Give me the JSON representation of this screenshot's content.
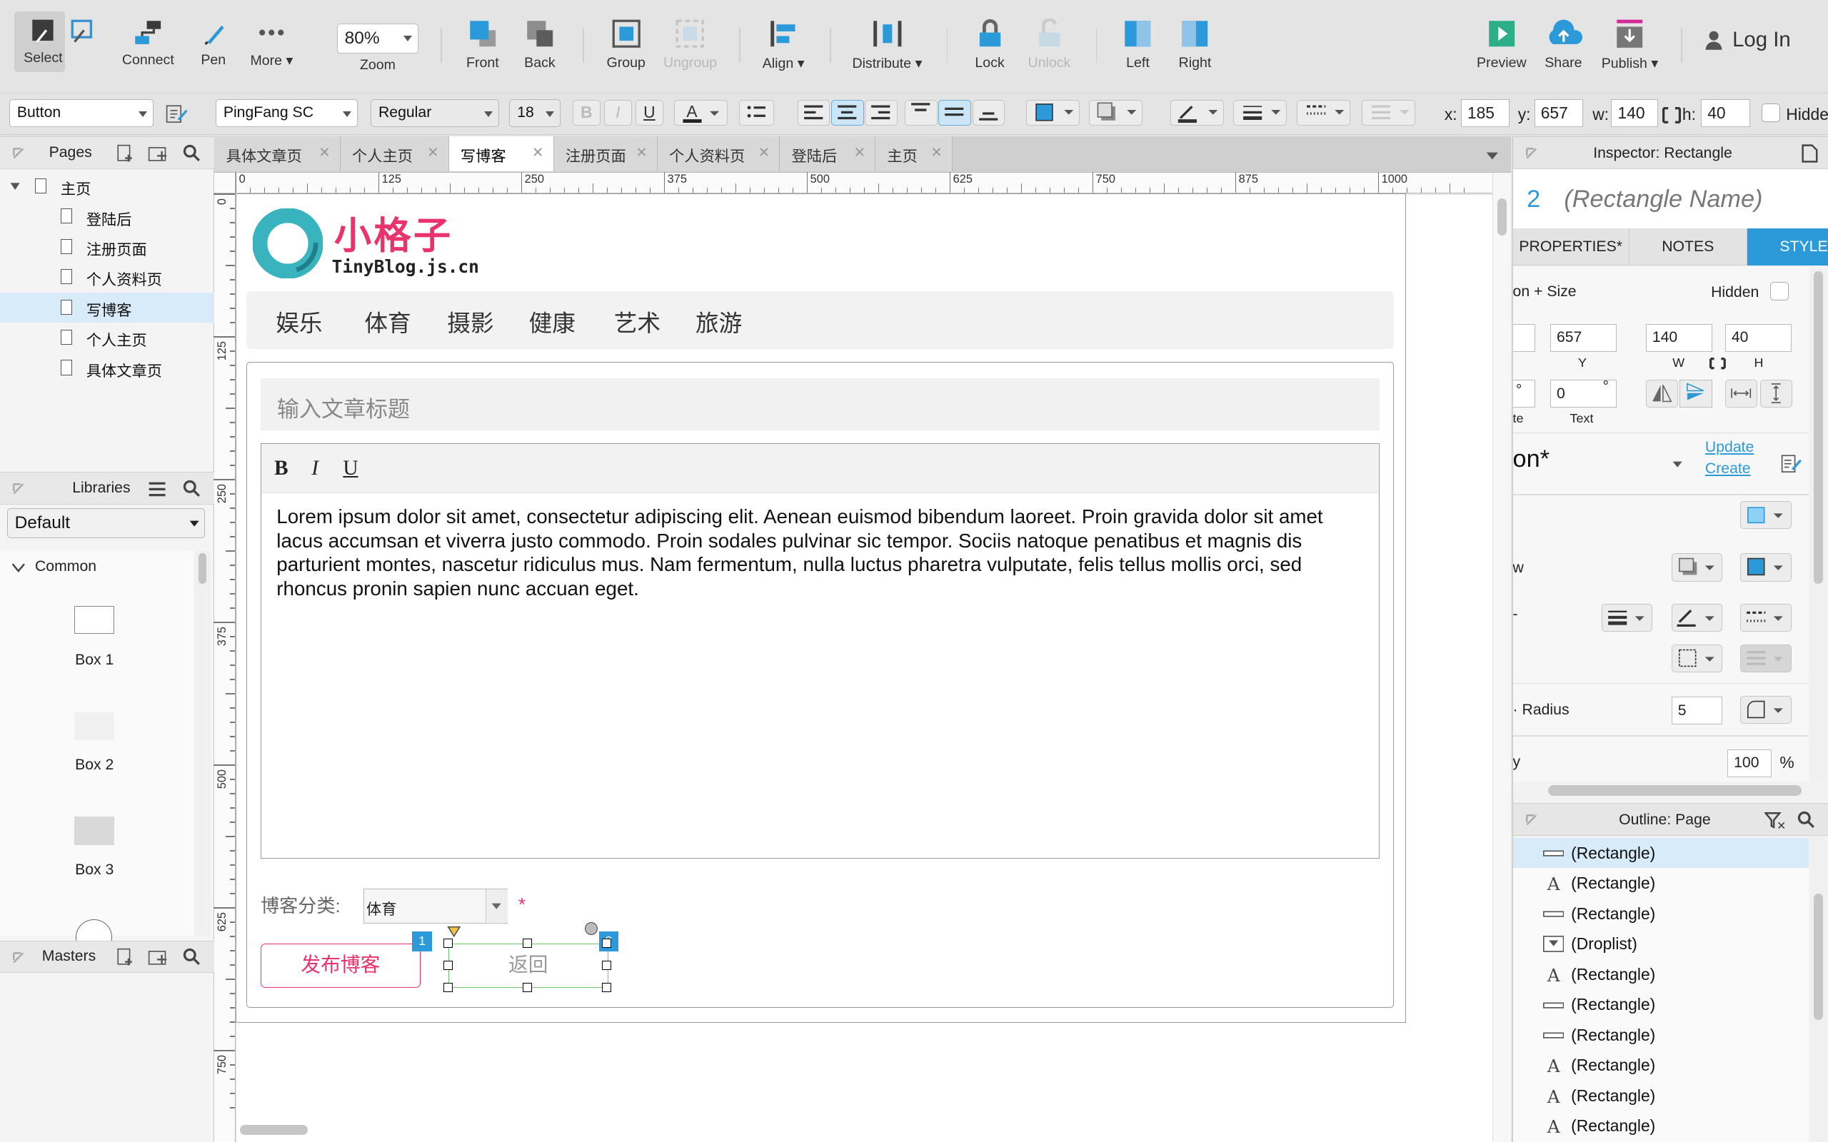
{
  "toolbar": {
    "select": "Select",
    "connect": "Connect",
    "pen": "Pen",
    "more": "More ▾",
    "zoom_value": "80%",
    "zoom": "Zoom",
    "front": "Front",
    "back": "Back",
    "group": "Group",
    "ungroup": "Ungroup",
    "align": "Align ▾",
    "distribute": "Distribute ▾",
    "lock": "Lock",
    "unlock": "Unlock",
    "left": "Left",
    "right": "Right",
    "preview": "Preview",
    "share": "Share",
    "publish": "Publish ▾",
    "login": "Log In"
  },
  "format": {
    "widget_type": "Button",
    "font_family": "PingFang SC",
    "font_weight": "Regular",
    "font_size": "18",
    "bold": "B",
    "italic": "I",
    "underline": "U",
    "x_label": "x:",
    "x": "185",
    "y_label": "y:",
    "y": "657",
    "w_label": "w:",
    "w": "140",
    "h_label": "h:",
    "h": "40",
    "hidden": "Hidde"
  },
  "pages": {
    "title": "Pages",
    "root": "主页",
    "children": [
      "登陆后",
      "注册页面",
      "个人资料页",
      "写博客",
      "个人主页",
      "具体文章页"
    ],
    "selected": "写博客"
  },
  "libraries": {
    "title": "Libraries",
    "selected": "Default",
    "group": "Common",
    "items": [
      "Box 1",
      "Box 2",
      "Box 3"
    ]
  },
  "masters": {
    "title": "Masters"
  },
  "tabs": [
    "具体文章页",
    "个人主页",
    "写博客",
    "注册页面",
    "个人资料页",
    "登陆后",
    "主页"
  ],
  "active_tab": "写博客",
  "ruler": {
    "h": [
      "0",
      "125",
      "250",
      "375",
      "500",
      "625",
      "750",
      "875",
      "1000"
    ],
    "v": [
      "0",
      "125",
      "250",
      "375",
      "500",
      "625",
      "750"
    ]
  },
  "page": {
    "logo_cn": "小格子",
    "logo_en": "TinyBlog.js.cn",
    "nav": [
      "娱乐",
      "体育",
      "摄影",
      "健康",
      "艺术",
      "旅游"
    ],
    "title_placeholder": "输入文章标题",
    "editor_bold": "B",
    "editor_italic": "I",
    "editor_underline": "U",
    "body": "Lorem ipsum dolor sit amet, consectetur adipiscing elit. Aenean euismod bibendum laoreet. Proin gravida dolor sit amet lacus accumsan et viverra justo commodo. Proin sodales pulvinar sic tempor. Sociis natoque penatibus et magnis dis parturient montes, nascetur ridiculus mus. Nam fermentum, nulla luctus pharetra vulputate, felis tellus mollis orci, sed rhoncus pronin sapien nunc accuan eget.",
    "category_label": "博客分类:",
    "category_value": "体育",
    "required": "*",
    "publish_button": "发布博客",
    "back_button": "返回",
    "badge1": "1",
    "badge2": "2"
  },
  "inspector": {
    "title": "Inspector: Rectangle",
    "number": "2",
    "name_placeholder": "(Rectangle Name)",
    "tabs": [
      "PROPERTIES*",
      "NOTES",
      "STYLE"
    ],
    "position_size": "on + Size",
    "hidden": "Hidden",
    "y": "657",
    "w": "140",
    "h": "40",
    "y_lbl": "Y",
    "w_lbl": "W",
    "h_lbl": "H",
    "deg": "°",
    "text_rot": "0",
    "text_rot_deg": "°",
    "rot_lbl": "te",
    "text_lbl": "Text",
    "style_name": "on*",
    "update": "Update",
    "create": "Create",
    "shadow_lbl": "w",
    "border_lbl": "-",
    "radius_lbl": "· Radius",
    "radius": "5",
    "opacity_lbl": "y",
    "opacity": "100",
    "pct": "%"
  },
  "outline": {
    "title": "Outline: Page",
    "items": [
      {
        "icon": "rect",
        "label": "(Rectangle)"
      },
      {
        "icon": "A",
        "label": "(Rectangle)"
      },
      {
        "icon": "rect",
        "label": "(Rectangle)"
      },
      {
        "icon": "drop",
        "label": "(Droplist)"
      },
      {
        "icon": "A",
        "label": "(Rectangle)"
      },
      {
        "icon": "rect",
        "label": "(Rectangle)"
      },
      {
        "icon": "rect",
        "label": "(Rectangle)"
      },
      {
        "icon": "A",
        "label": "(Rectangle)"
      },
      {
        "icon": "A",
        "label": "(Rectangle)"
      },
      {
        "icon": "A",
        "label": "(Rectangle)"
      }
    ]
  },
  "colors": {
    "accent": "#2c9ad8",
    "pink": "#e8336d",
    "teal": "#39b3be",
    "green": "#6bc86b"
  }
}
